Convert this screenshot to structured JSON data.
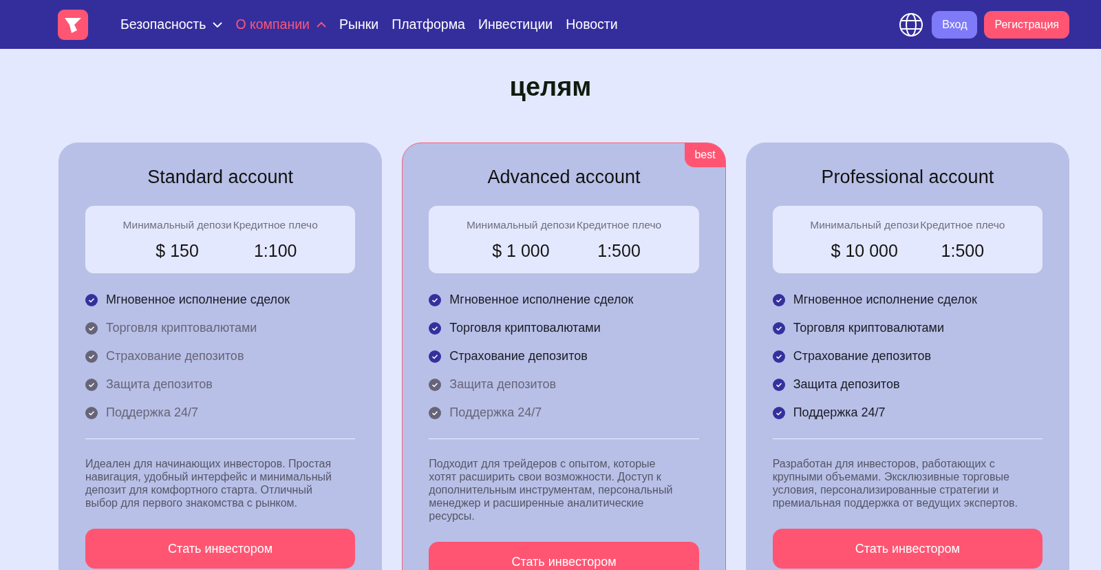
{
  "nav": [
    {
      "label": "Безопасность",
      "selected": false,
      "expanded": false
    },
    {
      "label": "О компании",
      "selected": true,
      "expanded": true
    },
    {
      "label": "Рынки",
      "selected": false
    },
    {
      "label": "Платформа",
      "selected": false
    },
    {
      "label": "Инвестиции",
      "selected": false
    },
    {
      "label": "Новости",
      "selected": false
    }
  ],
  "login": "Вход",
  "register": "Регистрация",
  "heading": "целям",
  "plans": [
    {
      "title": "Standard account",
      "featured": false,
      "stats": [
        {
          "label": "Минимальный депози",
          "value": "$ 150"
        },
        {
          "label": "Кредитное плечо",
          "value": "1:100"
        }
      ],
      "features": [
        {
          "text": "Мгновенное исполнение сделок",
          "included": true
        },
        {
          "text": "Торговля криптовалютами",
          "included": false
        },
        {
          "text": "Страхование депозитов",
          "included": false
        },
        {
          "text": "Защита депозитов",
          "included": false
        },
        {
          "text": "Поддержка 24/7",
          "included": false
        }
      ],
      "description": "Идеален для начинающих инвесторов. Простая навигация, удобный интерфейс и минимальный депозит для комфортного старта. Отличный выбор для первого знакомства с рынком.",
      "button": "Стать инвестором"
    },
    {
      "title": "Advanced account",
      "featured": true,
      "badge": "best",
      "stats": [
        {
          "label": "Минимальный депози",
          "value": "$ 1 000"
        },
        {
          "label": "Кредитное плечо",
          "value": "1:500"
        }
      ],
      "features": [
        {
          "text": "Мгновенное исполнение сделок",
          "included": true
        },
        {
          "text": "Торговля криптовалютами",
          "included": true
        },
        {
          "text": "Страхование депозитов",
          "included": true
        },
        {
          "text": "Защита депозитов",
          "included": false
        },
        {
          "text": "Поддержка 24/7",
          "included": false
        }
      ],
      "description": "Подходит для трейдеров с опытом, которые хотят расширить свои возможности. Доступ к дополнительным инструментам, персональный менеджер и расширенные аналитические ресурсы.",
      "button": "Стать инвестором"
    },
    {
      "title": "Professional account",
      "featured": false,
      "stats": [
        {
          "label": "Минимальный депози",
          "value": "$ 10 000"
        },
        {
          "label": "Кредитное плечо",
          "value": "1:500"
        }
      ],
      "features": [
        {
          "text": "Мгновенное исполнение сделок",
          "included": true
        },
        {
          "text": "Торговля криптовалютами",
          "included": true
        },
        {
          "text": "Страхование депозитов",
          "included": true
        },
        {
          "text": "Защита депозитов",
          "included": true
        },
        {
          "text": "Поддержка 24/7",
          "included": true
        }
      ],
      "description": "Разработан для инвесторов, работающих с крупными объемами. Эксклюзивные торговые условия, персонализированные стратегии и премиальная поддержка от ведущих экспертов.",
      "button": "Стать инвестором"
    }
  ]
}
